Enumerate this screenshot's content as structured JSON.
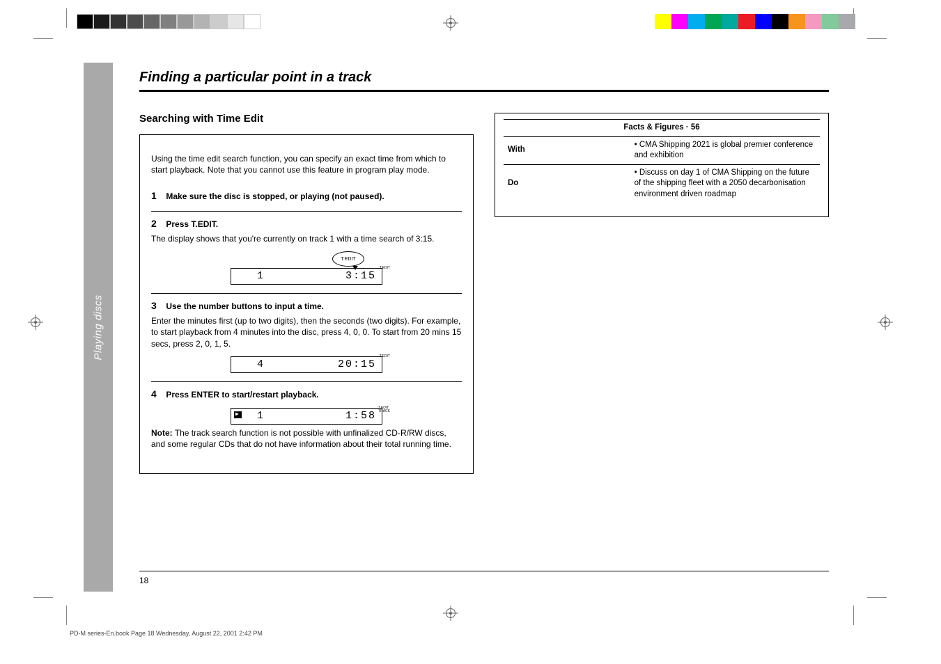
{
  "print_marks": {
    "gray_swatches": [
      "#000000",
      "#1a1a1a",
      "#333333",
      "#4d4d4d",
      "#666666",
      "#808080",
      "#999999",
      "#b3b3b3",
      "#cccccc",
      "#e6e6e6",
      "#ffffff"
    ],
    "color_swatches": [
      "#ffff00",
      "#ff00ff",
      "#00aeef",
      "#00a651",
      "#00a99d",
      "#ed1c24",
      "#0000ff",
      "#000000",
      "#f7941d",
      "#f49ac1",
      "#82ca9c",
      "#a7a9ac"
    ]
  },
  "side_tab": "Playing discs",
  "title": "Finding a particular point in a track",
  "subheading_left": "Searching with Time Edit",
  "box": {
    "intro": "Using the time edit search function, you can specify an exact time from which to start playback. Note that you cannot use this feature in program play mode.",
    "steps": [
      {
        "num": "1",
        "lead": "Make sure the disc is stopped, or playing (not paused).",
        "body": ""
      },
      {
        "num": "2",
        "lead": "Press T.EDIT.",
        "body": "The display shows that you're currently on track 1 with a time search of 3:15.",
        "lcd_button": "T.EDIT",
        "lcd_num": "1",
        "lcd_time": "3:15",
        "lcd_tag": "T.EDIT"
      },
      {
        "num": "3",
        "lead": "Use the number buttons to input a time.",
        "body": "Enter the minutes first (up to two digits), then the seconds (two digits). For example, to start playback from 4 minutes into the disc, press 4, 0, 0. To start from 20 mins 15 secs, press 2, 0, 1, 5.",
        "lcd_num": "4",
        "lcd_time": "20:15",
        "lcd_tag": "T.EDIT"
      },
      {
        "num": "4",
        "lead": "Press ENTER to start/restart playback.",
        "body": "",
        "lcd_num": "1",
        "lcd_time": "1:58",
        "lcd_tag": "T.EDIT\nTRACK",
        "indicator": "▶"
      }
    ],
    "note_label": "Note:",
    "note_body": "The track search function is not possible with unfinalized CD-R/RW discs, and some regular CDs that do not have information about their total running time."
  },
  "facts": {
    "title": "Facts & Figures · 56",
    "rows": [
      [
        "With",
        "• CMA Shipping 2021 is global premier conference and exhibition"
      ],
      [
        "Do",
        "• Discuss on day 1 of CMA Shipping on the future of the shipping fleet with a 2050 decarbonisation environment driven roadmap"
      ]
    ]
  },
  "page_number": "18",
  "footer_file": "PD-M series-En.book  Page 18  Wednesday, August 22, 2001  2:42 PM",
  "footer_date": ""
}
